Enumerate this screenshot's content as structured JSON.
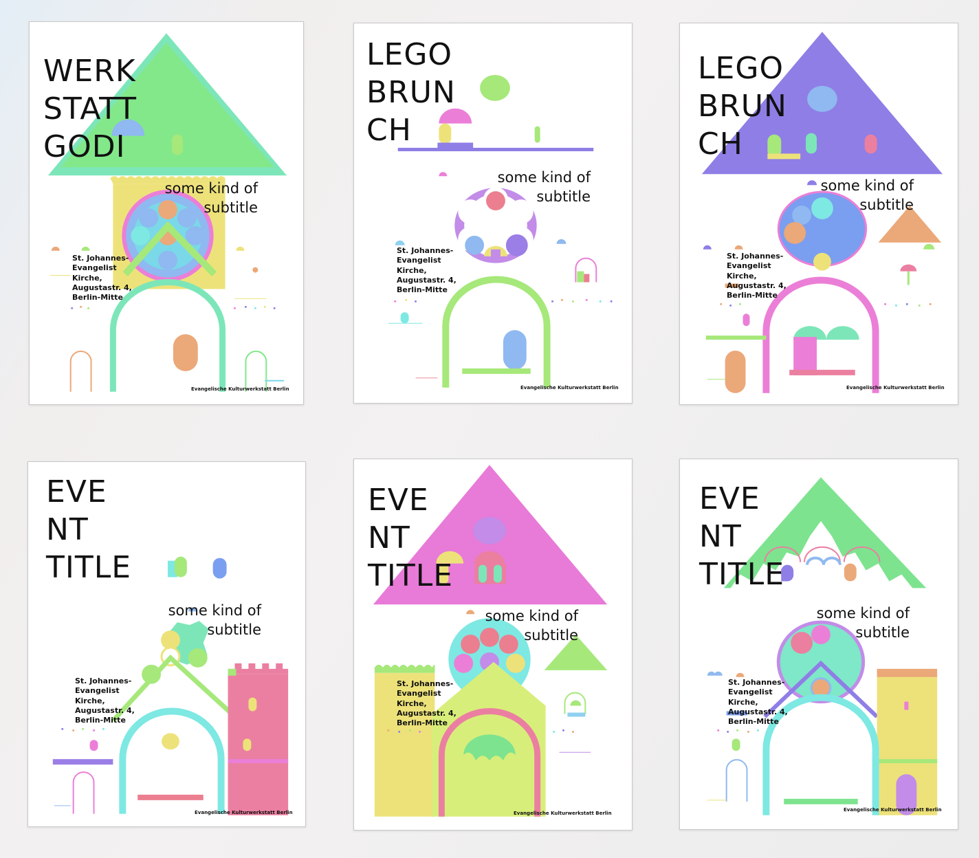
{
  "posters": [
    {
      "title": "WERK\nSTATT\nGODI",
      "subtitle": "some kind of\nsubtitle",
      "address": "St. Johannes-\nEvangelist\nKirche,\nAugustastr. 4,\nBerlin-Mitte",
      "footer": "Evangelische Kulturwerkstatt Berlin"
    },
    {
      "title": "LEGO\nBRUN\nCH",
      "subtitle": "some kind of\nsubtitle",
      "address": "St. Johannes-\nEvangelist\nKirche,\nAugustastr. 4,\nBerlin-Mitte",
      "footer": "Evangelische Kulturwerkstatt Berlin"
    },
    {
      "title": "LEGO\nBRUN\nCH",
      "subtitle": "some kind of\nsubtitle",
      "address": "St. Johannes-\nEvangelist\nKirche,\nAugustastr. 4,\nBerlin-Mitte",
      "footer": "Evangelische Kulturwerkstatt Berlin"
    },
    {
      "title": "EVE\nNT\nTITLE",
      "subtitle": "some kind of\nsubtitle",
      "address": "St. Johannes-\nEvangelist\nKirche,\nAugustastr. 4,\nBerlin-Mitte",
      "footer": "Evangelische Kulturwerkstatt Berlin"
    },
    {
      "title": "EVE\nNT\nTITLE",
      "subtitle": "some kind of\nsubtitle",
      "address": "St. Johannes-\nEvangelist\nKirche,\nAugustastr. 4,\nBerlin-Mitte",
      "footer": "Evangelische Kulturwerkstatt Berlin"
    },
    {
      "title": "EVE\nNT\nTITLE",
      "subtitle": "some kind of\nsubtitle",
      "address": "St. Johannes-\nEvangelist\nKirche,\nAugustastr. 4,\nBerlin-Mitte",
      "footer": "Evangelische Kulturwerkstatt Berlin"
    }
  ],
  "colors": {
    "green": "#7de38f",
    "mint": "#7de6b9",
    "yellow": "#ede27a",
    "blue": "#8fb9f0",
    "purple": "#8f7ee6",
    "pink": "#eb7fd7",
    "magenta": "#e87ad8",
    "lime": "#a6e87a",
    "orange": "#eba879",
    "teal": "#7ee8e3",
    "rose": "#eb7fa1"
  }
}
